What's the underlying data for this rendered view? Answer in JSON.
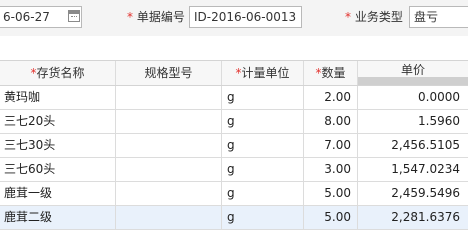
{
  "form": {
    "date_value": "6-06-27",
    "doc_no_label": "单据编号",
    "doc_no_value": "ID-2016-06-0013",
    "biz_type_label": "业务类型",
    "biz_type_value": "盘亏",
    "required_mark": "*"
  },
  "table": {
    "columns": [
      "存货名称",
      "规格型号",
      "计量单位",
      "数量",
      "单价"
    ],
    "required_columns": [
      "存货名称",
      "计量单位",
      "数量"
    ],
    "rows": [
      {
        "name": "黄玛咖",
        "spec": "",
        "unit": "g",
        "qty": "2.00",
        "price": "0.0000"
      },
      {
        "name": "三七20头",
        "spec": "",
        "unit": "g",
        "qty": "8.00",
        "price": "1.5960"
      },
      {
        "name": "三七30头",
        "spec": "",
        "unit": "g",
        "qty": "7.00",
        "price": "2,456.5105"
      },
      {
        "name": "三七60头",
        "spec": "",
        "unit": "g",
        "qty": "3.00",
        "price": "1,547.0234"
      },
      {
        "name": "鹿茸一级",
        "spec": "",
        "unit": "g",
        "qty": "5.00",
        "price": "2,459.5496"
      },
      {
        "name": "鹿茸二级",
        "spec": "",
        "unit": "g",
        "qty": "5.00",
        "price": "2,281.6376"
      }
    ],
    "selected_row_index": 5
  },
  "colors": {
    "required": "#e2302c",
    "selected_row": "#e9f1fb"
  }
}
